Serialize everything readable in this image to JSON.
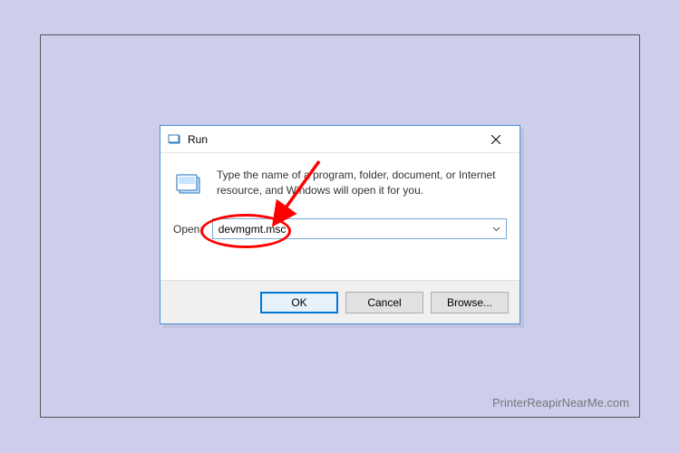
{
  "watermark": "PrinterReapirNearMe.com",
  "dialog": {
    "title": "Run",
    "description": "Type the name of a program, folder, document, or Internet resource, and Windows will open it for you.",
    "open_label": "Open:",
    "input_value": "devmgmt.msc",
    "buttons": {
      "ok": "OK",
      "cancel": "Cancel",
      "browse": "Browse..."
    }
  },
  "colors": {
    "accent": "#0078d7",
    "annotation": "#ff0000"
  }
}
